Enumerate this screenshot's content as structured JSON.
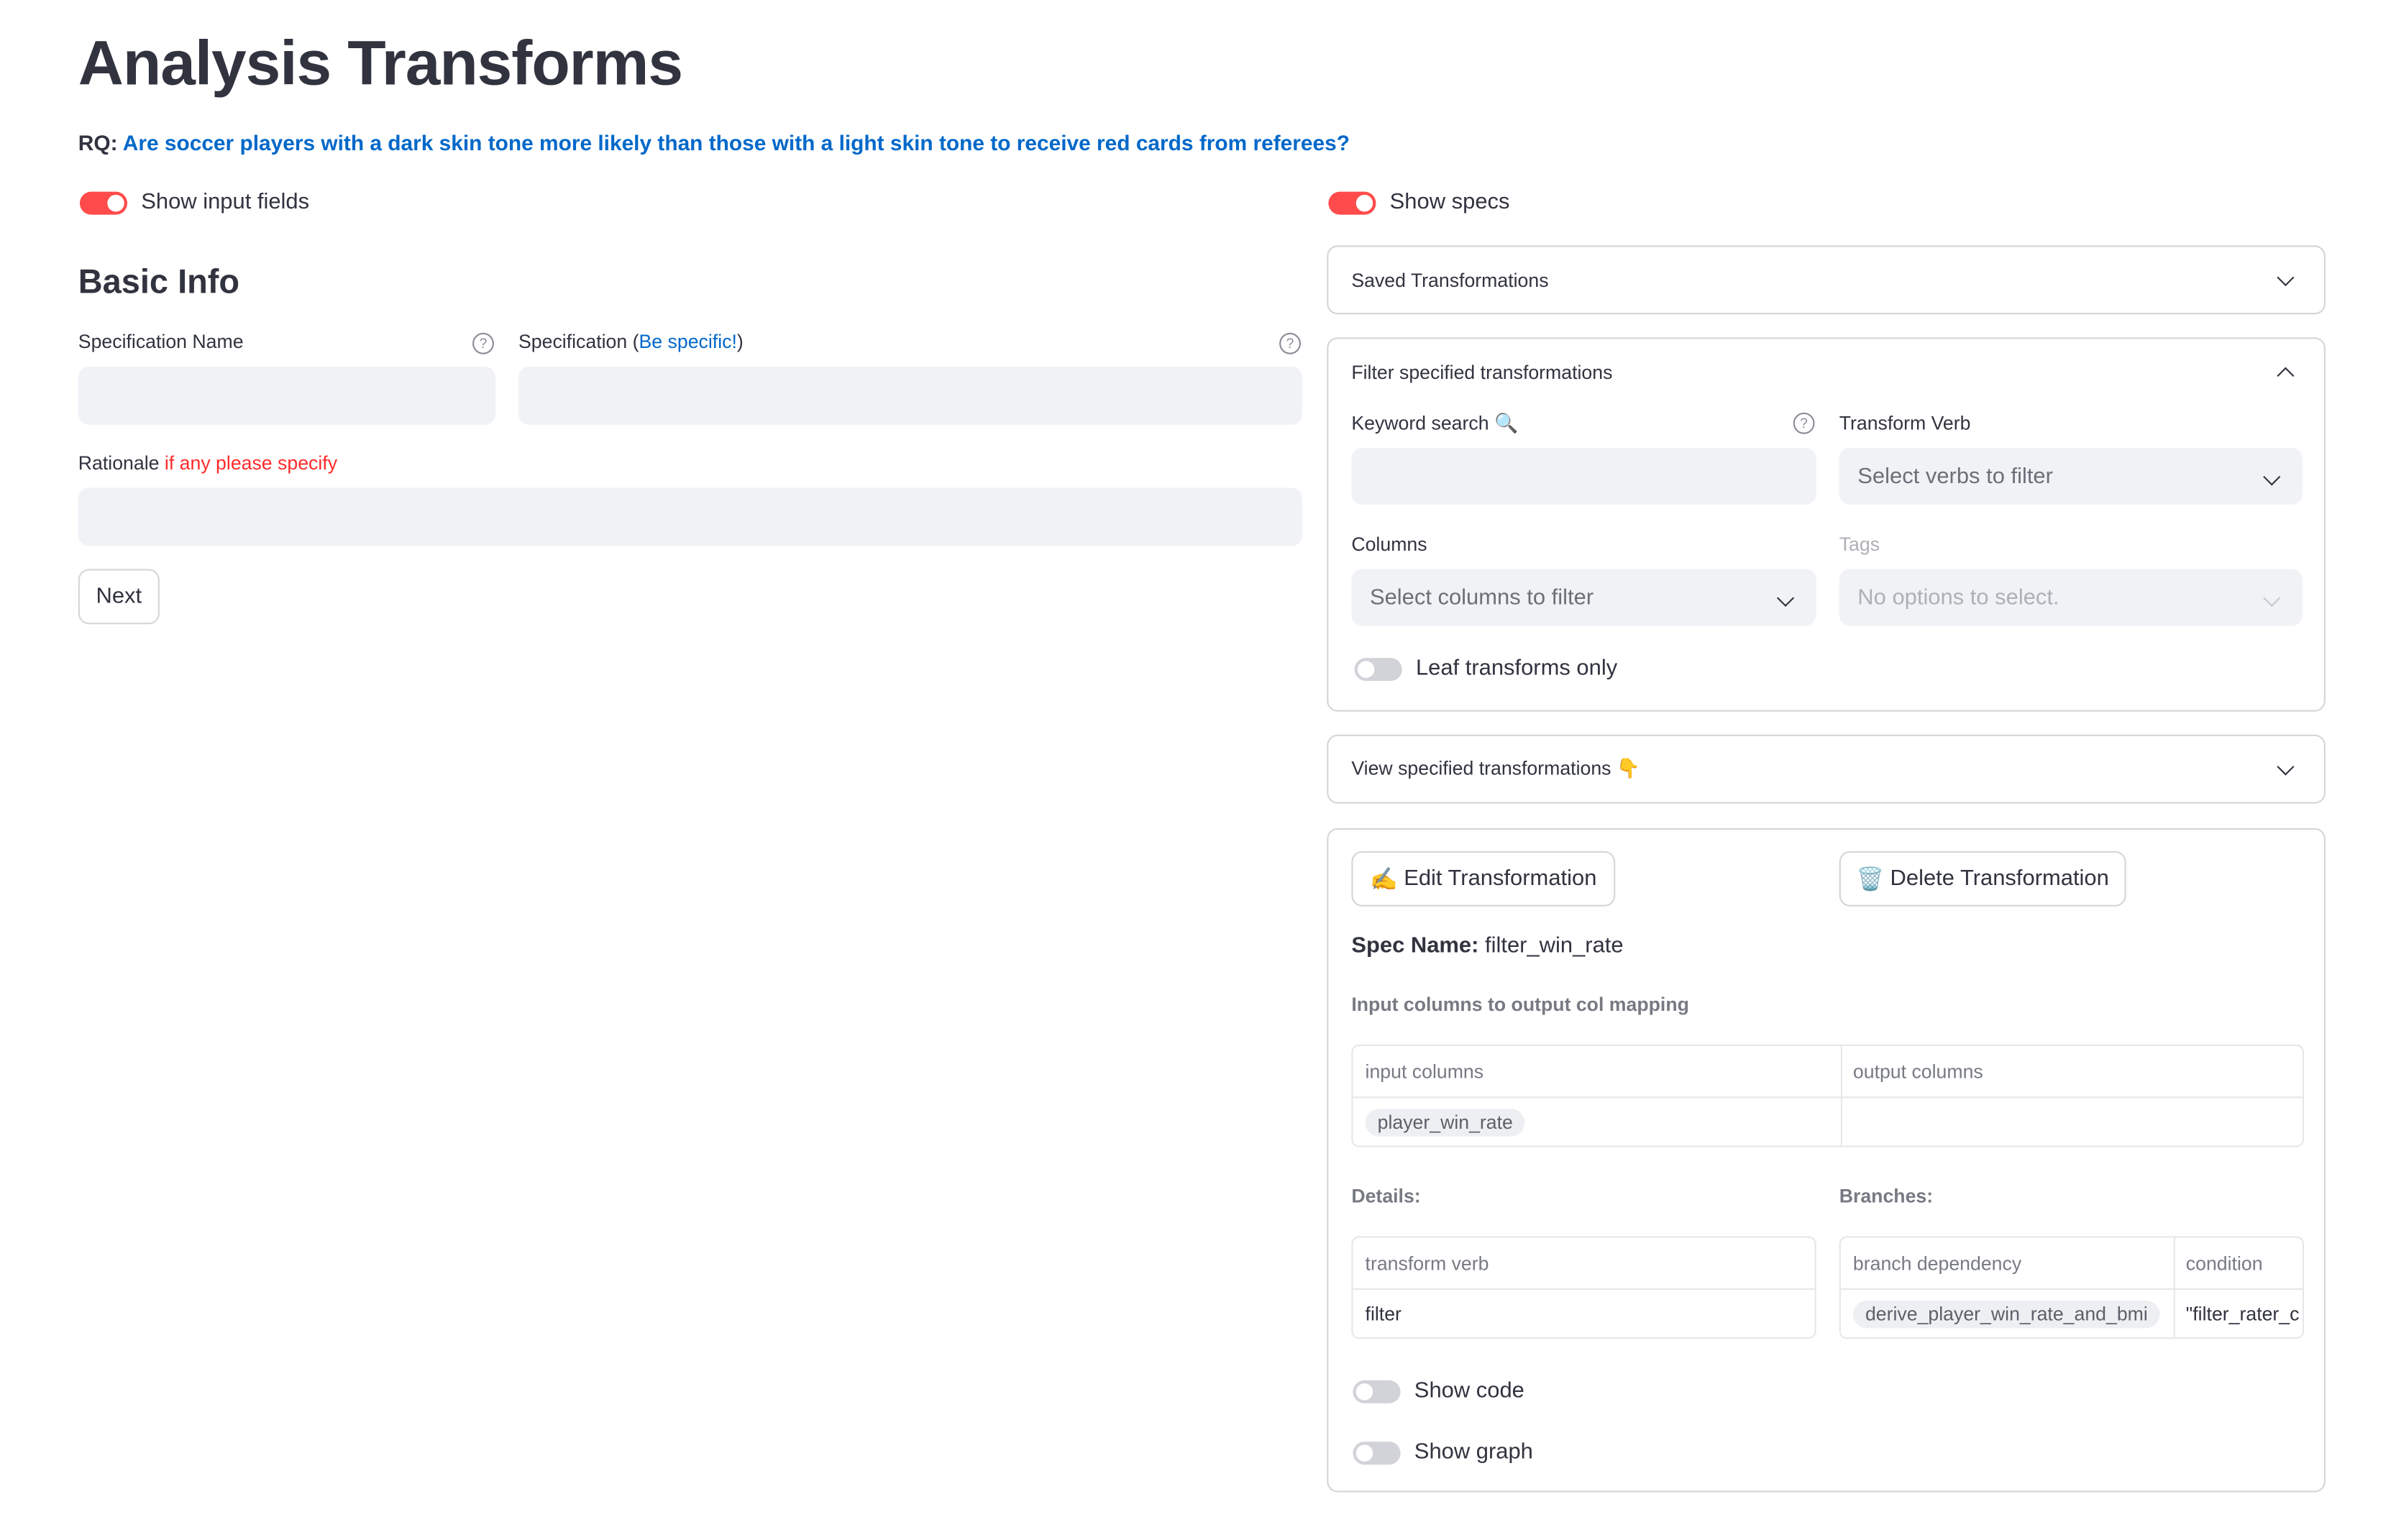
{
  "page": {
    "title": "Analysis Transforms",
    "rq_label": "RQ:",
    "rq_question": "Are soccer players with a dark skin tone more likely than those with a light skin tone to receive red cards from referees?"
  },
  "left": {
    "show_input_fields": {
      "label": "Show input fields",
      "on": true
    },
    "section_title": "Basic Info",
    "spec_name_label": "Specification Name",
    "spec_label_prefix": "Specification (",
    "spec_label_link": "Be specific!",
    "spec_label_suffix": ")",
    "rationale_label": "Rationale",
    "rationale_hint": "if any please specify",
    "help_glyph": "?",
    "next_button": "Next"
  },
  "right": {
    "show_specs": {
      "label": "Show specs",
      "on": true
    },
    "saved_transformations": "Saved Transformations",
    "filter_panel": {
      "title": "Filter specified transformations",
      "keyword_label": "Keyword search",
      "keyword_icon": "🔍",
      "verb_label": "Transform Verb",
      "verb_placeholder": "Select verbs to filter",
      "columns_label": "Columns",
      "columns_placeholder": "Select columns to filter",
      "tags_label": "Tags",
      "tags_placeholder": "No options to select.",
      "leaf_toggle": {
        "label": "Leaf transforms only",
        "on": false
      }
    },
    "view_specified": {
      "label": "View specified transformations",
      "icon": "👇"
    },
    "detail": {
      "edit_button": "Edit Transformation",
      "edit_icon": "✍️",
      "delete_button": "Delete Transformation",
      "delete_icon": "🗑️",
      "spec_name_label": "Spec Name:",
      "spec_name_value": "filter_win_rate",
      "mapping_title": "Input columns to output col mapping",
      "mapping_table": {
        "headers": [
          "input columns",
          "output columns"
        ],
        "rows": [
          [
            "player_win_rate",
            ""
          ]
        ]
      },
      "details_label": "Details:",
      "details_table": {
        "headers": [
          "transform verb"
        ],
        "rows": [
          [
            "filter"
          ]
        ]
      },
      "branches_label": "Branches:",
      "branches_table": {
        "headers": [
          "branch dependency",
          "condition"
        ],
        "rows": [
          [
            "derive_player_win_rate_and_bmi",
            "\"filter_rater_c"
          ]
        ]
      },
      "show_code": {
        "label": "Show code",
        "on": false
      },
      "show_graph": {
        "label": "Show graph",
        "on": false
      }
    }
  }
}
